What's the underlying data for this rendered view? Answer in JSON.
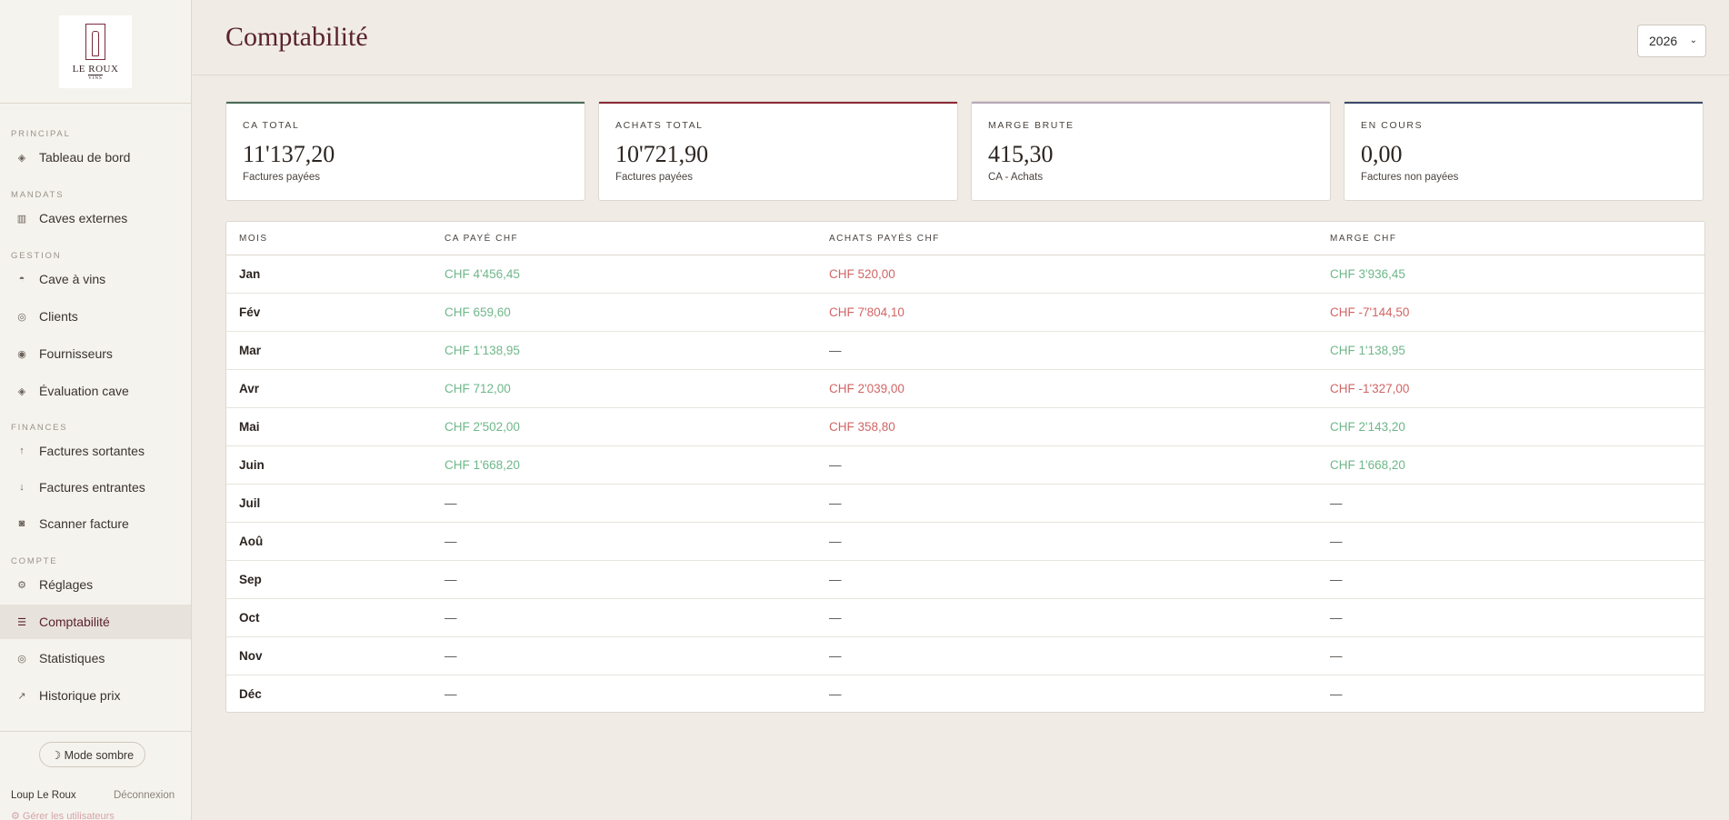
{
  "sidebar": {
    "logo": {
      "name": "LE ROUX",
      "sub": "VINS"
    },
    "sections": [
      {
        "label": "PRINCIPAL",
        "items": [
          {
            "label": "Tableau de bord",
            "icon": "diamond-icon",
            "glyph": "◈"
          }
        ]
      },
      {
        "label": "MANDATS",
        "items": [
          {
            "label": "Caves externes",
            "icon": "building-icon",
            "glyph": "▥"
          }
        ]
      },
      {
        "label": "GESTION",
        "items": [
          {
            "label": "Cave à vins",
            "icon": "wine-glass-icon",
            "glyph": "◓"
          },
          {
            "label": "Clients",
            "icon": "circle-ring-icon",
            "glyph": "◎"
          },
          {
            "label": "Fournisseurs",
            "icon": "circle-dot-icon",
            "glyph": "◉"
          },
          {
            "label": "Évaluation cave",
            "icon": "diamond-icon",
            "glyph": "◈"
          }
        ]
      },
      {
        "label": "FINANCES",
        "items": [
          {
            "label": "Factures sortantes",
            "icon": "arrow-up-icon",
            "glyph": "↑"
          },
          {
            "label": "Factures entrantes",
            "icon": "arrow-down-icon",
            "glyph": "↓"
          },
          {
            "label": "Scanner facture",
            "icon": "camera-icon",
            "glyph": "◙"
          }
        ]
      },
      {
        "label": "COMPTE",
        "items": [
          {
            "label": "Réglages",
            "icon": "gear-icon",
            "glyph": "⚙"
          },
          {
            "label": "Comptabilité",
            "icon": "list-icon",
            "glyph": "☰"
          },
          {
            "label": "Statistiques",
            "icon": "circle-ring-icon",
            "glyph": "◎"
          },
          {
            "label": "Historique prix",
            "icon": "trend-arrow-icon",
            "glyph": "↗"
          }
        ]
      }
    ],
    "dark_mode_label": "☽ Mode sombre",
    "user_name": "Loup Le Roux",
    "logout_label": "Déconnexion",
    "manage_users_label": "⚙ Gérer les utilisateurs"
  },
  "header": {
    "title": "Comptabilité",
    "year": "2026"
  },
  "cards": [
    {
      "label": "CA TOTAL",
      "value": "11'137,20",
      "sub": "Factures payées",
      "color": "#4a6b5a"
    },
    {
      "label": "ACHATS TOTAL",
      "value": "10'721,90",
      "sub": "Factures payées",
      "color": "#8a2a36"
    },
    {
      "label": "MARGE BRUTE",
      "value": "415,30",
      "sub": "CA - Achats",
      "color": "#b8a8b8"
    },
    {
      "label": "EN COURS",
      "value": "0,00",
      "sub": "Factures non payées",
      "color": "#3a4a6a"
    }
  ],
  "table": {
    "headers": [
      "MOIS",
      "CA PAYÉ CHF",
      "ACHATS PAYÉS CHF",
      "MARGE CHF"
    ],
    "rows": [
      [
        "Jan",
        "CHF 4'456,45",
        "CHF 520,00",
        "CHF 3'936,45"
      ],
      [
        "Fév",
        "CHF 659,60",
        "CHF 7'804,10",
        "CHF -7'144,50"
      ],
      [
        "Mar",
        "CHF 1'138,95",
        "—",
        "CHF 1'138,95"
      ],
      [
        "Avr",
        "CHF 712,00",
        "CHF 2'039,00",
        "CHF -1'327,00"
      ],
      [
        "Mai",
        "CHF 2'502,00",
        "CHF 358,80",
        "CHF 2'143,20"
      ],
      [
        "Juin",
        "CHF 1'668,20",
        "—",
        "CHF 1'668,20"
      ],
      [
        "Juil",
        "—",
        "—",
        "—"
      ],
      [
        "Aoû",
        "—",
        "—",
        "—"
      ],
      [
        "Sep",
        "—",
        "—",
        "—"
      ],
      [
        "Oct",
        "—",
        "—",
        "—"
      ],
      [
        "Nov",
        "—",
        "—",
        "—"
      ],
      [
        "Déc",
        "—",
        "—",
        "—"
      ]
    ]
  },
  "colors": {
    "positive": "#6fb78a",
    "negative": "#d16565",
    "accent": "#5a2230"
  }
}
